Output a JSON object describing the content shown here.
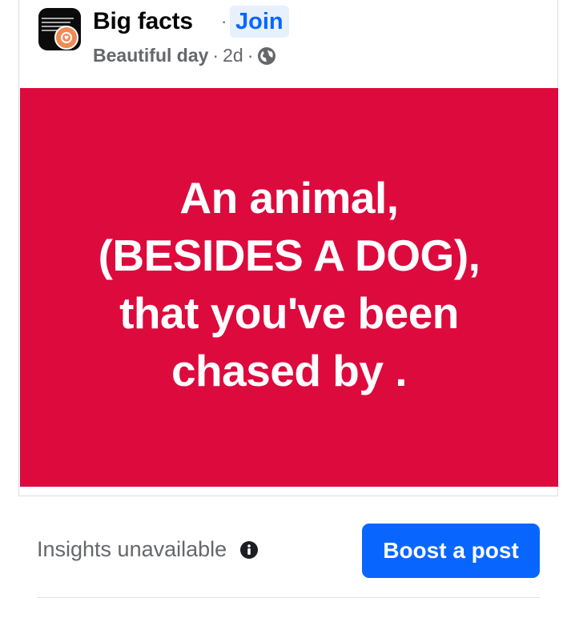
{
  "post": {
    "group_name": "Big facts",
    "separator": "·",
    "join_label": "Join",
    "author": "Beautiful day",
    "time": "2d",
    "visibility_icon": "globe-icon",
    "text": "An animal,\n(BESIDES A DOG),\nthat you've been\nchased by  .",
    "background_color": "#dd0a3d"
  },
  "footer": {
    "insights_text": "Insights unavailable",
    "info_icon": "info-icon",
    "boost_label": "Boost a post"
  },
  "colors": {
    "accent": "#0866ff",
    "secondary_text": "#65676b"
  }
}
